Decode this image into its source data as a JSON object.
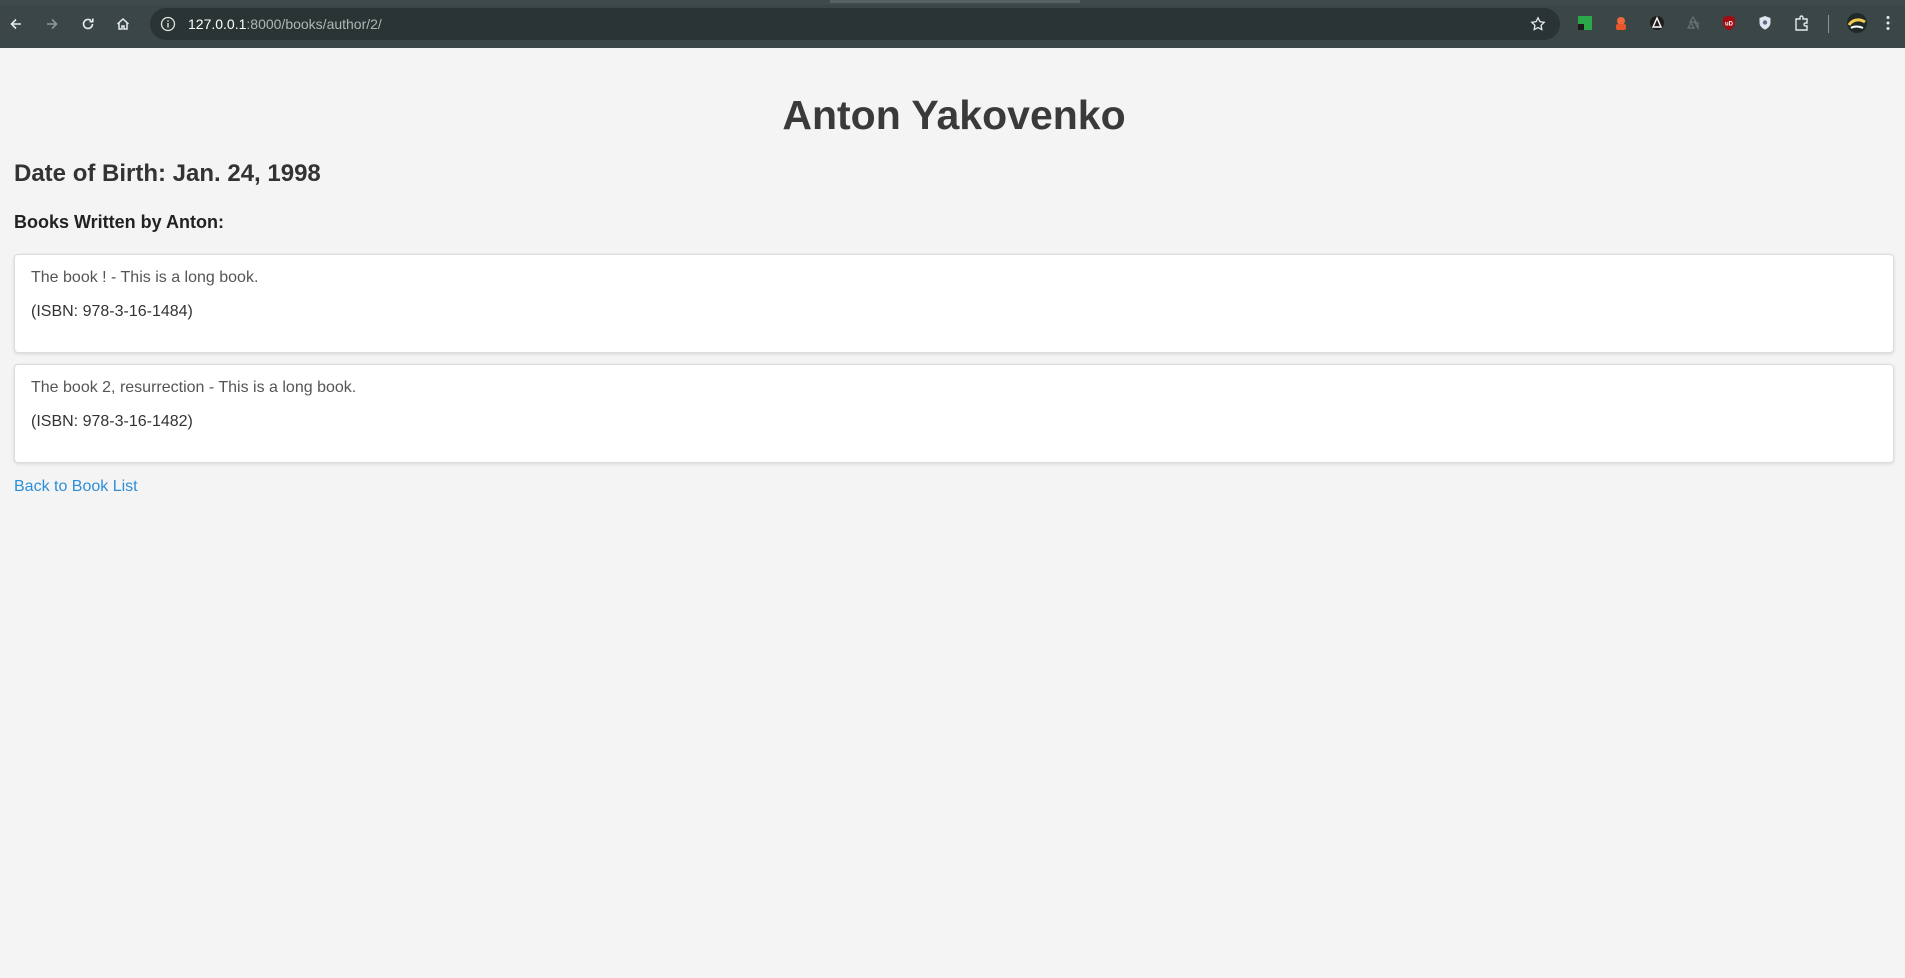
{
  "browser": {
    "url_host": "127.0.0.1",
    "url_rest": ":8000/books/author/2/"
  },
  "author": {
    "name": "Anton Yakovenko",
    "dob_line": "Date of Birth: Jan. 24, 1998",
    "books_heading": "Books Written by Anton:"
  },
  "books": [
    {
      "title_line": "The book ! - This is a long book.",
      "isbn_line": "(ISBN: 978-3-16-1484)"
    },
    {
      "title_line": "The book 2, resurrection - This is a long book.",
      "isbn_line": "(ISBN: 978-3-16-1482)"
    }
  ],
  "links": {
    "back": "Back to Book List"
  },
  "colors": {
    "toolbar": "#3b4646",
    "page_bg": "#f4f4f4",
    "link": "#2d8fd9"
  }
}
